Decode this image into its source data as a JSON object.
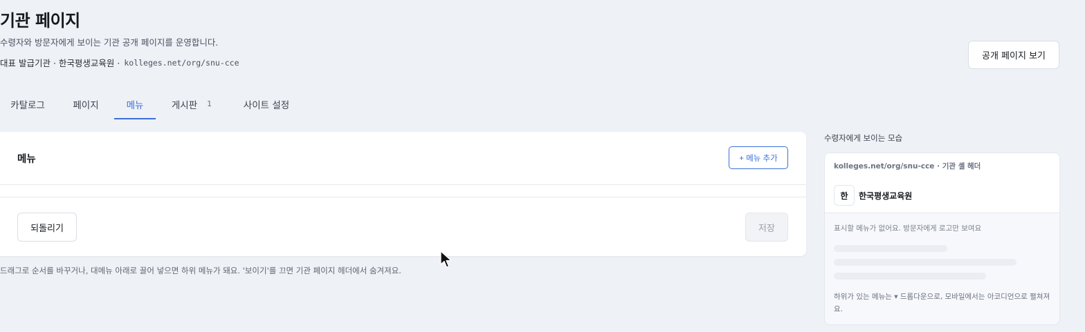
{
  "header": {
    "title": "기관 페이지",
    "subtitle": "수령자와 방문자에게 보이는 기관 공개 페이지를 운영합니다.",
    "meta_label": "대표 발급기관 · 한국평생교육원 ·",
    "meta_url": "kolleges.net/org/snu-cce",
    "public_page_button": "공개 페이지 보기"
  },
  "tabs": [
    {
      "label": "카탈로그",
      "active": false
    },
    {
      "label": "페이지",
      "active": false
    },
    {
      "label": "메뉴",
      "active": true
    },
    {
      "label": "게시판",
      "count": "1",
      "active": false
    },
    {
      "label": "사이트 설정",
      "active": false
    }
  ],
  "menu_card": {
    "title": "메뉴",
    "add_button": "+ 메뉴 추가",
    "revert_button": "되돌리기",
    "save_button": "저장",
    "hint": "드래그로 순서를 바꾸거나, 대메뉴 아래로 끌어 넣으면 하위 메뉴가 돼요. '보이기'를 끄면 기관 페이지 헤더에서 숨겨져요."
  },
  "preview": {
    "label": "수령자에게 보이는 모습",
    "url_line": "kolleges.net/org/snu-cce · 기관 셸 헤더",
    "logo_char": "한",
    "org_name": "한국평생교육원",
    "empty_text": "표시할 메뉴가 없어요. 방문자에게 로고만 보여요",
    "footer_text": "하위가 있는 메뉴는 ▾ 드롭다운으로, 모바일에서는 아코디언으로 펼쳐져요."
  },
  "colors": {
    "accent": "#3a6fd8",
    "background": "#eef1f6",
    "card": "#ffffff"
  }
}
